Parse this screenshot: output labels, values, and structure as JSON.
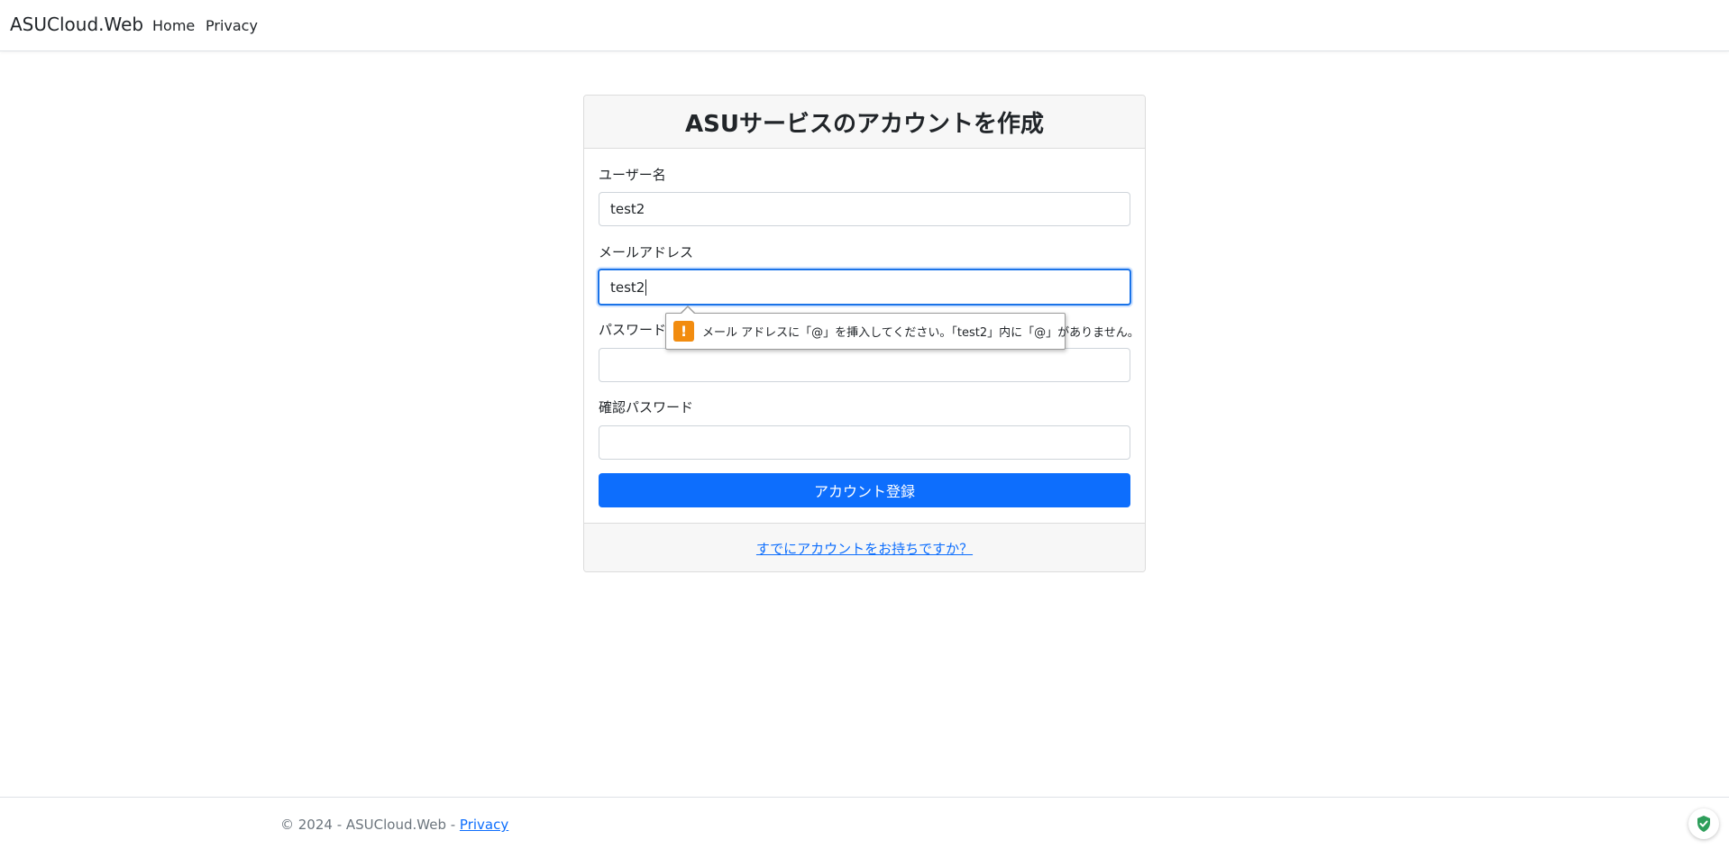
{
  "nav": {
    "brand": "ASUCloud.Web",
    "links": [
      "Home",
      "Privacy"
    ]
  },
  "card": {
    "title": "ASUサービスのアカウントを作成",
    "fields": {
      "username": {
        "label": "ユーザー名",
        "value": "test2"
      },
      "email": {
        "label": "メールアドレス",
        "value": "test2"
      },
      "password": {
        "label": "パスワード",
        "value": ""
      },
      "confirm_password": {
        "label": "確認パスワード",
        "value": ""
      }
    },
    "submit_label": "アカウント登録",
    "login_link": "すでにアカウントをお持ちですか？"
  },
  "validation": {
    "message": "メール アドレスに「@」を挿入してください。「test2」内に「@」がありません。",
    "icon": "warning-icon",
    "icon_glyph": "!"
  },
  "footer": {
    "copyright": "© 2024 - ASUCloud.Web - ",
    "privacy_link": "Privacy"
  },
  "colors": {
    "primary": "#0d6efd",
    "warning": "#f28c0f",
    "shield": "#2e9e5b"
  }
}
